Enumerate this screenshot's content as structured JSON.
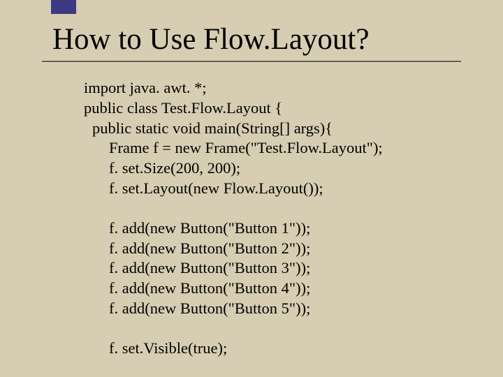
{
  "title": "How to Use Flow.Layout?",
  "code": {
    "l1": "import java. awt. *;",
    "l2": "public class Test.Flow.Layout {",
    "l3": "public static void main(String[] args){",
    "l4": "Frame f = new Frame(\"Test.Flow.Layout\");",
    "l5": "f. set.Size(200, 200);",
    "l6": "f. set.Layout(new Flow.Layout());",
    "l7": "f. add(new Button(\"Button 1\"));",
    "l8": "f. add(new Button(\"Button 2\"));",
    "l9": "f. add(new Button(\"Button 3\"));",
    "l10": "f. add(new Button(\"Button 4\"));",
    "l11": "f. add(new Button(\"Button 5\"));",
    "l12": "f. set.Visible(true);"
  }
}
